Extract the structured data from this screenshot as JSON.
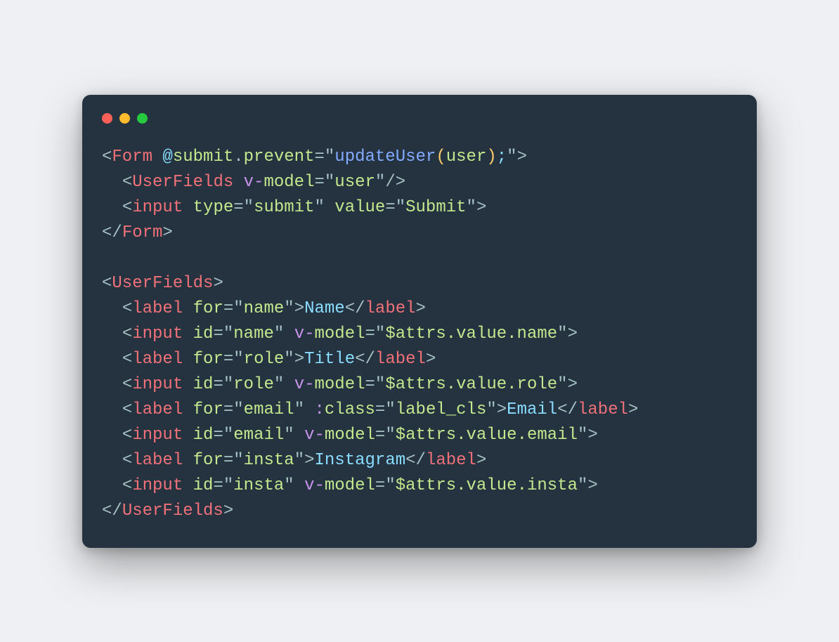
{
  "colors": {
    "background_page": "#eef0f3",
    "background_window": "#253240",
    "traffic_red": "#ff5f56",
    "traffic_yellow": "#ffbd2e",
    "traffic_green": "#27c93f",
    "punctuation": "#a6c3c4",
    "tag_name": "#f07178",
    "attribute": "#c3e88d",
    "string": "#c3e88d",
    "text_content": "#89ddff",
    "sigil": "#89ddff",
    "function": "#82aaff",
    "keyword_prefix": "#c792ea",
    "parens": "#ffcb6b"
  },
  "code": {
    "lines": [
      {
        "indent": 0,
        "tokens": [
          {
            "t": "punct",
            "v": "<"
          },
          {
            "t": "tag",
            "v": "Form"
          },
          {
            "t": "plain",
            "v": " "
          },
          {
            "t": "sigil",
            "v": "@"
          },
          {
            "t": "attr",
            "v": "submit"
          },
          {
            "t": "punct",
            "v": "."
          },
          {
            "t": "attr",
            "v": "prevent"
          },
          {
            "t": "punct",
            "v": "="
          },
          {
            "t": "punct",
            "v": "\""
          },
          {
            "t": "func",
            "v": "updateUser"
          },
          {
            "t": "paren",
            "v": "("
          },
          {
            "t": "string",
            "v": "user"
          },
          {
            "t": "paren",
            "v": ")"
          },
          {
            "t": "sigil",
            "v": ";"
          },
          {
            "t": "punct",
            "v": "\""
          },
          {
            "t": "punct",
            "v": ">"
          }
        ]
      },
      {
        "indent": 1,
        "tokens": [
          {
            "t": "punct",
            "v": "<"
          },
          {
            "t": "tag",
            "v": "UserFields"
          },
          {
            "t": "plain",
            "v": " "
          },
          {
            "t": "kw",
            "v": "v-"
          },
          {
            "t": "attr",
            "v": "model"
          },
          {
            "t": "punct",
            "v": "="
          },
          {
            "t": "punct",
            "v": "\""
          },
          {
            "t": "string",
            "v": "user"
          },
          {
            "t": "punct",
            "v": "\""
          },
          {
            "t": "punct",
            "v": "/>"
          }
        ]
      },
      {
        "indent": 1,
        "tokens": [
          {
            "t": "punct",
            "v": "<"
          },
          {
            "t": "tag",
            "v": "input"
          },
          {
            "t": "plain",
            "v": " "
          },
          {
            "t": "attr",
            "v": "type"
          },
          {
            "t": "punct",
            "v": "="
          },
          {
            "t": "punct",
            "v": "\""
          },
          {
            "t": "string",
            "v": "submit"
          },
          {
            "t": "punct",
            "v": "\""
          },
          {
            "t": "plain",
            "v": " "
          },
          {
            "t": "attr",
            "v": "value"
          },
          {
            "t": "punct",
            "v": "="
          },
          {
            "t": "punct",
            "v": "\""
          },
          {
            "t": "string",
            "v": "Submit"
          },
          {
            "t": "punct",
            "v": "\""
          },
          {
            "t": "punct",
            "v": ">"
          }
        ]
      },
      {
        "indent": 0,
        "tokens": [
          {
            "t": "punct",
            "v": "</"
          },
          {
            "t": "tag",
            "v": "Form"
          },
          {
            "t": "punct",
            "v": ">"
          }
        ]
      },
      {
        "indent": 0,
        "tokens": []
      },
      {
        "indent": 0,
        "tokens": [
          {
            "t": "punct",
            "v": "<"
          },
          {
            "t": "tag",
            "v": "UserFields"
          },
          {
            "t": "punct",
            "v": ">"
          }
        ]
      },
      {
        "indent": 1,
        "tokens": [
          {
            "t": "punct",
            "v": "<"
          },
          {
            "t": "tag",
            "v": "label"
          },
          {
            "t": "plain",
            "v": " "
          },
          {
            "t": "attr",
            "v": "for"
          },
          {
            "t": "punct",
            "v": "="
          },
          {
            "t": "punct",
            "v": "\""
          },
          {
            "t": "string",
            "v": "name"
          },
          {
            "t": "punct",
            "v": "\""
          },
          {
            "t": "punct",
            "v": ">"
          },
          {
            "t": "content",
            "v": "Name"
          },
          {
            "t": "punct",
            "v": "</"
          },
          {
            "t": "tag",
            "v": "label"
          },
          {
            "t": "punct",
            "v": ">"
          }
        ]
      },
      {
        "indent": 1,
        "tokens": [
          {
            "t": "punct",
            "v": "<"
          },
          {
            "t": "tag",
            "v": "input"
          },
          {
            "t": "plain",
            "v": " "
          },
          {
            "t": "attr",
            "v": "id"
          },
          {
            "t": "punct",
            "v": "="
          },
          {
            "t": "punct",
            "v": "\""
          },
          {
            "t": "string",
            "v": "name"
          },
          {
            "t": "punct",
            "v": "\""
          },
          {
            "t": "plain",
            "v": " "
          },
          {
            "t": "kw",
            "v": "v-"
          },
          {
            "t": "attr",
            "v": "model"
          },
          {
            "t": "punct",
            "v": "="
          },
          {
            "t": "punct",
            "v": "\""
          },
          {
            "t": "string",
            "v": "$attrs.value.name"
          },
          {
            "t": "punct",
            "v": "\""
          },
          {
            "t": "punct",
            "v": ">"
          }
        ]
      },
      {
        "indent": 1,
        "tokens": [
          {
            "t": "punct",
            "v": "<"
          },
          {
            "t": "tag",
            "v": "label"
          },
          {
            "t": "plain",
            "v": " "
          },
          {
            "t": "attr",
            "v": "for"
          },
          {
            "t": "punct",
            "v": "="
          },
          {
            "t": "punct",
            "v": "\""
          },
          {
            "t": "string",
            "v": "role"
          },
          {
            "t": "punct",
            "v": "\""
          },
          {
            "t": "punct",
            "v": ">"
          },
          {
            "t": "content",
            "v": "Title"
          },
          {
            "t": "punct",
            "v": "</"
          },
          {
            "t": "tag",
            "v": "label"
          },
          {
            "t": "punct",
            "v": ">"
          }
        ]
      },
      {
        "indent": 1,
        "tokens": [
          {
            "t": "punct",
            "v": "<"
          },
          {
            "t": "tag",
            "v": "input"
          },
          {
            "t": "plain",
            "v": " "
          },
          {
            "t": "attr",
            "v": "id"
          },
          {
            "t": "punct",
            "v": "="
          },
          {
            "t": "punct",
            "v": "\""
          },
          {
            "t": "string",
            "v": "role"
          },
          {
            "t": "punct",
            "v": "\""
          },
          {
            "t": "plain",
            "v": " "
          },
          {
            "t": "kw",
            "v": "v-"
          },
          {
            "t": "attr",
            "v": "model"
          },
          {
            "t": "punct",
            "v": "="
          },
          {
            "t": "punct",
            "v": "\""
          },
          {
            "t": "string",
            "v": "$attrs.value.role"
          },
          {
            "t": "punct",
            "v": "\""
          },
          {
            "t": "punct",
            "v": ">"
          }
        ]
      },
      {
        "indent": 1,
        "tokens": [
          {
            "t": "punct",
            "v": "<"
          },
          {
            "t": "tag",
            "v": "label"
          },
          {
            "t": "plain",
            "v": " "
          },
          {
            "t": "attr",
            "v": "for"
          },
          {
            "t": "punct",
            "v": "="
          },
          {
            "t": "punct",
            "v": "\""
          },
          {
            "t": "string",
            "v": "email"
          },
          {
            "t": "punct",
            "v": "\""
          },
          {
            "t": "plain",
            "v": " "
          },
          {
            "t": "kw",
            "v": ":"
          },
          {
            "t": "attr",
            "v": "class"
          },
          {
            "t": "punct",
            "v": "="
          },
          {
            "t": "punct",
            "v": "\""
          },
          {
            "t": "string",
            "v": "label_cls"
          },
          {
            "t": "punct",
            "v": "\""
          },
          {
            "t": "punct",
            "v": ">"
          },
          {
            "t": "content",
            "v": "Email"
          },
          {
            "t": "punct",
            "v": "</"
          },
          {
            "t": "tag",
            "v": "label"
          },
          {
            "t": "punct",
            "v": ">"
          }
        ]
      },
      {
        "indent": 1,
        "tokens": [
          {
            "t": "punct",
            "v": "<"
          },
          {
            "t": "tag",
            "v": "input"
          },
          {
            "t": "plain",
            "v": " "
          },
          {
            "t": "attr",
            "v": "id"
          },
          {
            "t": "punct",
            "v": "="
          },
          {
            "t": "punct",
            "v": "\""
          },
          {
            "t": "string",
            "v": "email"
          },
          {
            "t": "punct",
            "v": "\""
          },
          {
            "t": "plain",
            "v": " "
          },
          {
            "t": "kw",
            "v": "v-"
          },
          {
            "t": "attr",
            "v": "model"
          },
          {
            "t": "punct",
            "v": "="
          },
          {
            "t": "punct",
            "v": "\""
          },
          {
            "t": "string",
            "v": "$attrs.value.email"
          },
          {
            "t": "punct",
            "v": "\""
          },
          {
            "t": "punct",
            "v": ">"
          }
        ]
      },
      {
        "indent": 1,
        "tokens": [
          {
            "t": "punct",
            "v": "<"
          },
          {
            "t": "tag",
            "v": "label"
          },
          {
            "t": "plain",
            "v": " "
          },
          {
            "t": "attr",
            "v": "for"
          },
          {
            "t": "punct",
            "v": "="
          },
          {
            "t": "punct",
            "v": "\""
          },
          {
            "t": "string",
            "v": "insta"
          },
          {
            "t": "punct",
            "v": "\""
          },
          {
            "t": "punct",
            "v": ">"
          },
          {
            "t": "content",
            "v": "Instagram"
          },
          {
            "t": "punct",
            "v": "</"
          },
          {
            "t": "tag",
            "v": "label"
          },
          {
            "t": "punct",
            "v": ">"
          }
        ]
      },
      {
        "indent": 1,
        "tokens": [
          {
            "t": "punct",
            "v": "<"
          },
          {
            "t": "tag",
            "v": "input"
          },
          {
            "t": "plain",
            "v": " "
          },
          {
            "t": "attr",
            "v": "id"
          },
          {
            "t": "punct",
            "v": "="
          },
          {
            "t": "punct",
            "v": "\""
          },
          {
            "t": "string",
            "v": "insta"
          },
          {
            "t": "punct",
            "v": "\""
          },
          {
            "t": "plain",
            "v": " "
          },
          {
            "t": "kw",
            "v": "v-"
          },
          {
            "t": "attr",
            "v": "model"
          },
          {
            "t": "punct",
            "v": "="
          },
          {
            "t": "punct",
            "v": "\""
          },
          {
            "t": "string",
            "v": "$attrs.value.insta"
          },
          {
            "t": "punct",
            "v": "\""
          },
          {
            "t": "punct",
            "v": ">"
          }
        ]
      },
      {
        "indent": 0,
        "tokens": [
          {
            "t": "punct",
            "v": "</"
          },
          {
            "t": "tag",
            "v": "UserFields"
          },
          {
            "t": "punct",
            "v": ">"
          }
        ]
      }
    ]
  }
}
